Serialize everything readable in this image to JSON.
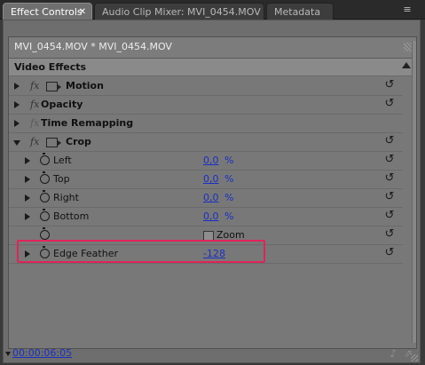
{
  "tabs": [
    {
      "label": "Effect Controls",
      "active": true,
      "close": "✕"
    },
    {
      "label": "Audio Clip Mixer: MVI_0454.MOV",
      "active": false
    },
    {
      "label": "Metadata",
      "active": false
    }
  ],
  "panel_menu_icon": "≡",
  "clip": {
    "title": "MVI_0454.MOV * MVI_0454.MOV"
  },
  "video_effects": {
    "title": "Video Effects"
  },
  "fx_symbol": "fx",
  "reset_symbol": "↺",
  "effects": {
    "motion": {
      "name": "Motion"
    },
    "opacity": {
      "name": "Opacity"
    },
    "time_remapping": {
      "name": "Time Remapping"
    },
    "crop": {
      "name": "Crop"
    }
  },
  "crop_properties": {
    "left": {
      "name": "Left",
      "value": "0,0",
      "unit": "%"
    },
    "top": {
      "name": "Top",
      "value": "0,0",
      "unit": "%"
    },
    "right": {
      "name": "Right",
      "value": "0,0",
      "unit": "%"
    },
    "bottom": {
      "name": "Bottom",
      "value": "0,0",
      "unit": "%"
    },
    "zoom": {
      "name": "Zoom",
      "checked": false
    },
    "edge_feather": {
      "name": "Edge Feather",
      "value": "-128"
    }
  },
  "bottom": {
    "timecode": "00:00:06:05",
    "audio_icon": "♪",
    "export_icon": "⇗"
  },
  "colors": {
    "highlight": "#e0245a",
    "value_link": "#1a2fc0",
    "active_tab": "#707070"
  }
}
